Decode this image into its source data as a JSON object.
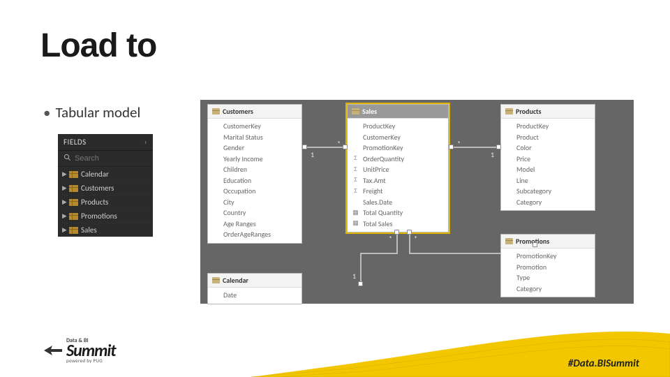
{
  "slide": {
    "title": "Load to",
    "bullet": "Tabular model",
    "hashtag": "#Data.BISummit"
  },
  "logo": {
    "line1": "Data & BI",
    "line2": "Summit",
    "line3": "powered by PUG"
  },
  "fields_panel": {
    "title": "FIELDS",
    "search_placeholder": "Search",
    "tables": [
      "Calendar",
      "Customers",
      "Products",
      "Promotions",
      "Sales"
    ]
  },
  "entities": {
    "customers": {
      "title": "Customers",
      "fields": [
        {
          "name": "CustomerKey",
          "icon": ""
        },
        {
          "name": "Marital Status",
          "icon": ""
        },
        {
          "name": "Gender",
          "icon": ""
        },
        {
          "name": "Yearly Income",
          "icon": ""
        },
        {
          "name": "Children",
          "icon": ""
        },
        {
          "name": "Education",
          "icon": ""
        },
        {
          "name": "Occupation",
          "icon": ""
        },
        {
          "name": "City",
          "icon": ""
        },
        {
          "name": "Country",
          "icon": ""
        },
        {
          "name": "Age Ranges",
          "icon": ""
        },
        {
          "name": "OrderAgeRanges",
          "icon": ""
        }
      ]
    },
    "sales": {
      "title": "Sales",
      "fields": [
        {
          "name": "ProductKey",
          "icon": ""
        },
        {
          "name": "CustomerKey",
          "icon": ""
        },
        {
          "name": "PromotionKey",
          "icon": ""
        },
        {
          "name": "OrderQuantity",
          "icon": "Σ"
        },
        {
          "name": "UnitPrice",
          "icon": "Σ"
        },
        {
          "name": "Tax.Amt",
          "icon": "Σ"
        },
        {
          "name": "Freight",
          "icon": "Σ"
        },
        {
          "name": "Sales.Date",
          "icon": ""
        },
        {
          "name": "Total Quantity",
          "icon": "▦"
        },
        {
          "name": "Total Sales",
          "icon": "▦"
        }
      ]
    },
    "products": {
      "title": "Products",
      "fields": [
        {
          "name": "ProductKey",
          "icon": ""
        },
        {
          "name": "Product",
          "icon": ""
        },
        {
          "name": "Color",
          "icon": ""
        },
        {
          "name": "Price",
          "icon": ""
        },
        {
          "name": "Model",
          "icon": ""
        },
        {
          "name": "Line",
          "icon": ""
        },
        {
          "name": "Subcategory",
          "icon": ""
        },
        {
          "name": "Category",
          "icon": ""
        }
      ]
    },
    "promotions": {
      "title": "Promotions",
      "fields": [
        {
          "name": "PromotionKey",
          "icon": ""
        },
        {
          "name": "Promotion",
          "icon": ""
        },
        {
          "name": "Type",
          "icon": ""
        },
        {
          "name": "Category",
          "icon": ""
        }
      ]
    },
    "calendar": {
      "title": "Calendar",
      "fields": [
        {
          "name": "Date",
          "icon": ""
        }
      ]
    }
  }
}
